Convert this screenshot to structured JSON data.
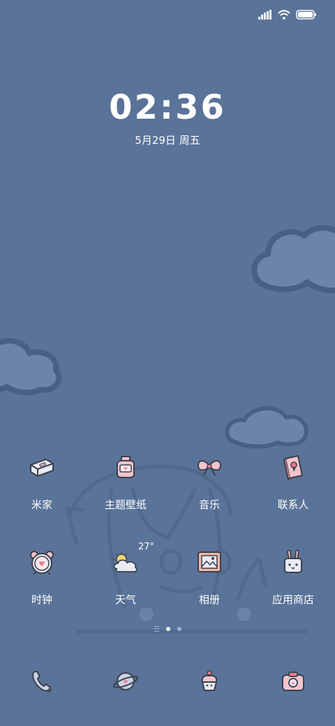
{
  "status_bar": {
    "icons": [
      "signal-icon",
      "wifi-icon",
      "battery-icon"
    ],
    "battery_level": 1.0
  },
  "lockscreen": {
    "time": "02:36",
    "date": "5月29日 周五"
  },
  "home": {
    "row1": [
      {
        "label": "米家",
        "icon": "mijia-icon"
      },
      {
        "label": "主题壁纸",
        "icon": "theme-icon"
      },
      {
        "label": "音乐",
        "icon": "music-bow-icon"
      },
      {
        "label": "联系人",
        "icon": "contacts-book-icon"
      }
    ],
    "row2": [
      {
        "label": "时钟",
        "icon": "alarm-clock-icon"
      },
      {
        "label": "天气",
        "icon": "weather-icon",
        "temp": "27°"
      },
      {
        "label": "相册",
        "icon": "gallery-frame-icon"
      },
      {
        "label": "应用商店",
        "icon": "bunny-store-icon"
      }
    ]
  },
  "page_indicator": {
    "pages": 2,
    "current": 1
  },
  "dock": [
    {
      "icon": "phone-icon"
    },
    {
      "icon": "browser-planet-icon"
    },
    {
      "icon": "cupcake-icon"
    },
    {
      "icon": "camera-icon"
    }
  ],
  "colors": {
    "background": "#5a7399",
    "cloud": "#6b84a8",
    "cloud_outline": "#476183",
    "icon_pink": "#f4c4cc",
    "icon_outline": "#3a3f4c"
  }
}
